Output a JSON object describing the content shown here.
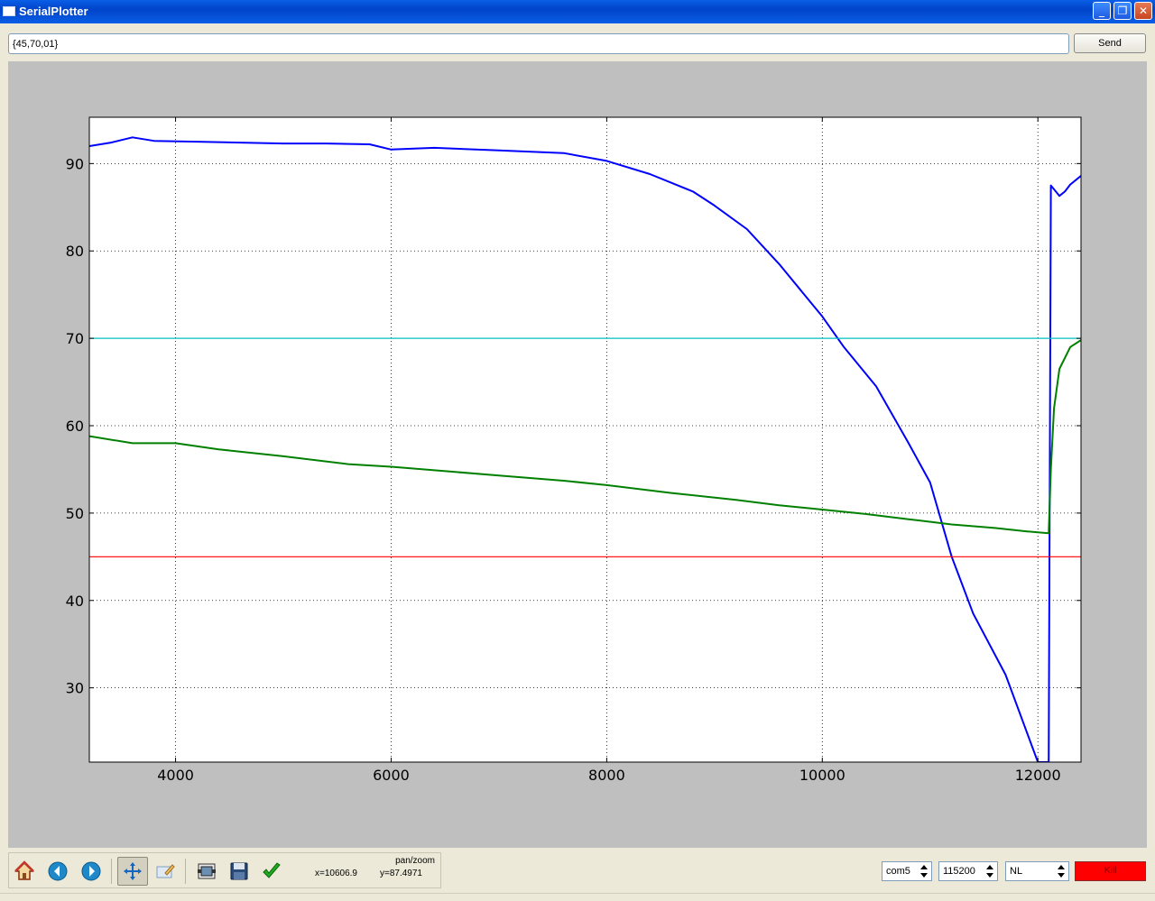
{
  "window": {
    "title": "SerialPlotter",
    "minimize_label": "_",
    "restore_label": "❐",
    "close_label": "✕"
  },
  "command": {
    "value": "{45,70,01}",
    "send_label": "Send"
  },
  "toolbar": {
    "icons": [
      "home-icon",
      "back-arrow-icon",
      "forward-arrow-icon",
      "pan-move-icon",
      "zoom-edit-icon",
      "subplot-config-icon",
      "save-floppy-icon",
      "checkmark-icon"
    ],
    "x_readout": "x=10606.9",
    "y_readout": "y=87.4971",
    "mode": "pan/zoom"
  },
  "controls": {
    "port": "com5",
    "baud": "115200",
    "line_ending": "NL",
    "kill_label": "Kill",
    "kill_color": "#ff0000"
  },
  "chart_data": {
    "type": "line",
    "title": "",
    "xlabel": "",
    "ylabel": "",
    "xlim": [
      3200,
      12400
    ],
    "ylim": [
      21.5,
      95.3
    ],
    "xticks": [
      4000,
      6000,
      8000,
      10000,
      12000
    ],
    "yticks": [
      30,
      40,
      50,
      60,
      70,
      80,
      90
    ],
    "grid": true,
    "series": [
      {
        "color": "#0000ff",
        "x": [
          3200,
          3400,
          3600,
          3800,
          4200,
          4600,
          5000,
          5400,
          5800,
          6000,
          6400,
          7000,
          7600,
          8000,
          8400,
          8800,
          9000,
          9300,
          9600,
          10000,
          10200,
          10500,
          10800,
          11000,
          11200,
          11400,
          11700,
          12000,
          12080,
          12100,
          12120,
          12200,
          12250,
          12300,
          12400
        ],
        "y": [
          92.0,
          92.4,
          93.0,
          92.6,
          92.5,
          92.4,
          92.3,
          92.3,
          92.2,
          91.6,
          91.8,
          91.5,
          91.2,
          90.3,
          88.8,
          86.8,
          85.2,
          82.5,
          78.5,
          72.5,
          69.0,
          64.5,
          58.0,
          53.5,
          45.0,
          38.5,
          31.5,
          21.5,
          21.5,
          21.5,
          87.5,
          86.3,
          86.8,
          87.6,
          88.6
        ]
      },
      {
        "color": "#008000",
        "x": [
          3200,
          3600,
          4000,
          4400,
          5000,
          5600,
          6000,
          6400,
          7000,
          7600,
          8000,
          8600,
          9200,
          9600,
          10000,
          10400,
          10800,
          11200,
          11600,
          11900,
          12100,
          12120,
          12150,
          12200,
          12300,
          12400
        ],
        "y": [
          58.8,
          58.0,
          58.0,
          57.3,
          56.5,
          55.6,
          55.3,
          54.9,
          54.3,
          53.7,
          53.2,
          52.3,
          51.5,
          50.9,
          50.4,
          49.9,
          49.3,
          48.7,
          48.3,
          47.9,
          47.7,
          55.0,
          62.0,
          66.5,
          69.0,
          69.8
        ]
      },
      {
        "color": "#00bfbf",
        "x": [
          3200,
          12400
        ],
        "y": [
          70,
          70
        ]
      },
      {
        "color": "#ff0000",
        "x": [
          3200,
          12400
        ],
        "y": [
          45,
          45
        ]
      }
    ]
  }
}
